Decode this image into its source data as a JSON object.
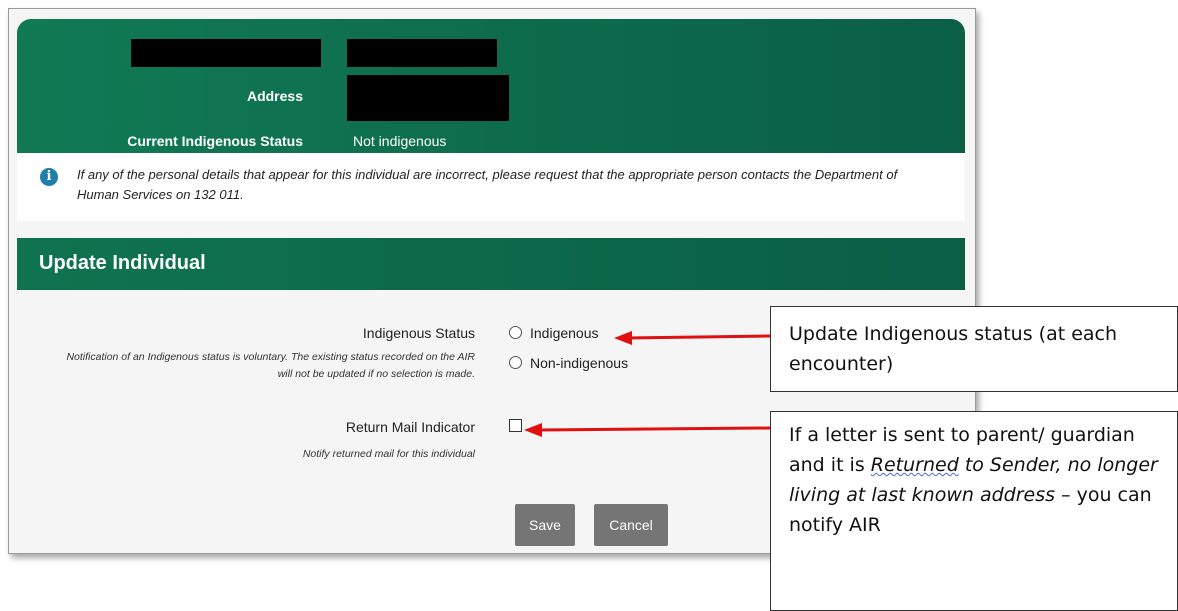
{
  "header": {
    "address_label": "Address",
    "indigenous_status_label": "Current Indigenous Status",
    "indigenous_status_value": "Not indigenous"
  },
  "info": {
    "message": "If any of the personal details that appear for this individual are incorrect, please request that the appropriate person contacts the Department of Human Services on 132 011."
  },
  "section": {
    "title": "Update Individual"
  },
  "form": {
    "indigenous_status_label": "Indigenous Status",
    "indigenous_status_help": "Notification of an Indigenous status is voluntary. The existing status recorded on the AIR will not be updated if no selection is made.",
    "options": [
      "Indigenous",
      "Non-indigenous"
    ],
    "return_mail_label": "Return Mail Indicator",
    "return_mail_help": "Notify returned mail for this individual",
    "save_label": "Save",
    "cancel_label": "Cancel"
  },
  "annotations": {
    "callout1": "Update Indigenous status (at each encounter)",
    "callout2_part1": "If a letter is sent to parent/ guardian and it is ",
    "callout2_returned": "Returned",
    "callout2_italic": " to Sender, no longer living at last known address",
    "callout2_part2": " – you can notify AIR"
  },
  "colors": {
    "header_green": "#0a6b4c",
    "button_gray": "#757575",
    "arrow_red": "#e01010",
    "info_blue": "#1f7fa8"
  }
}
